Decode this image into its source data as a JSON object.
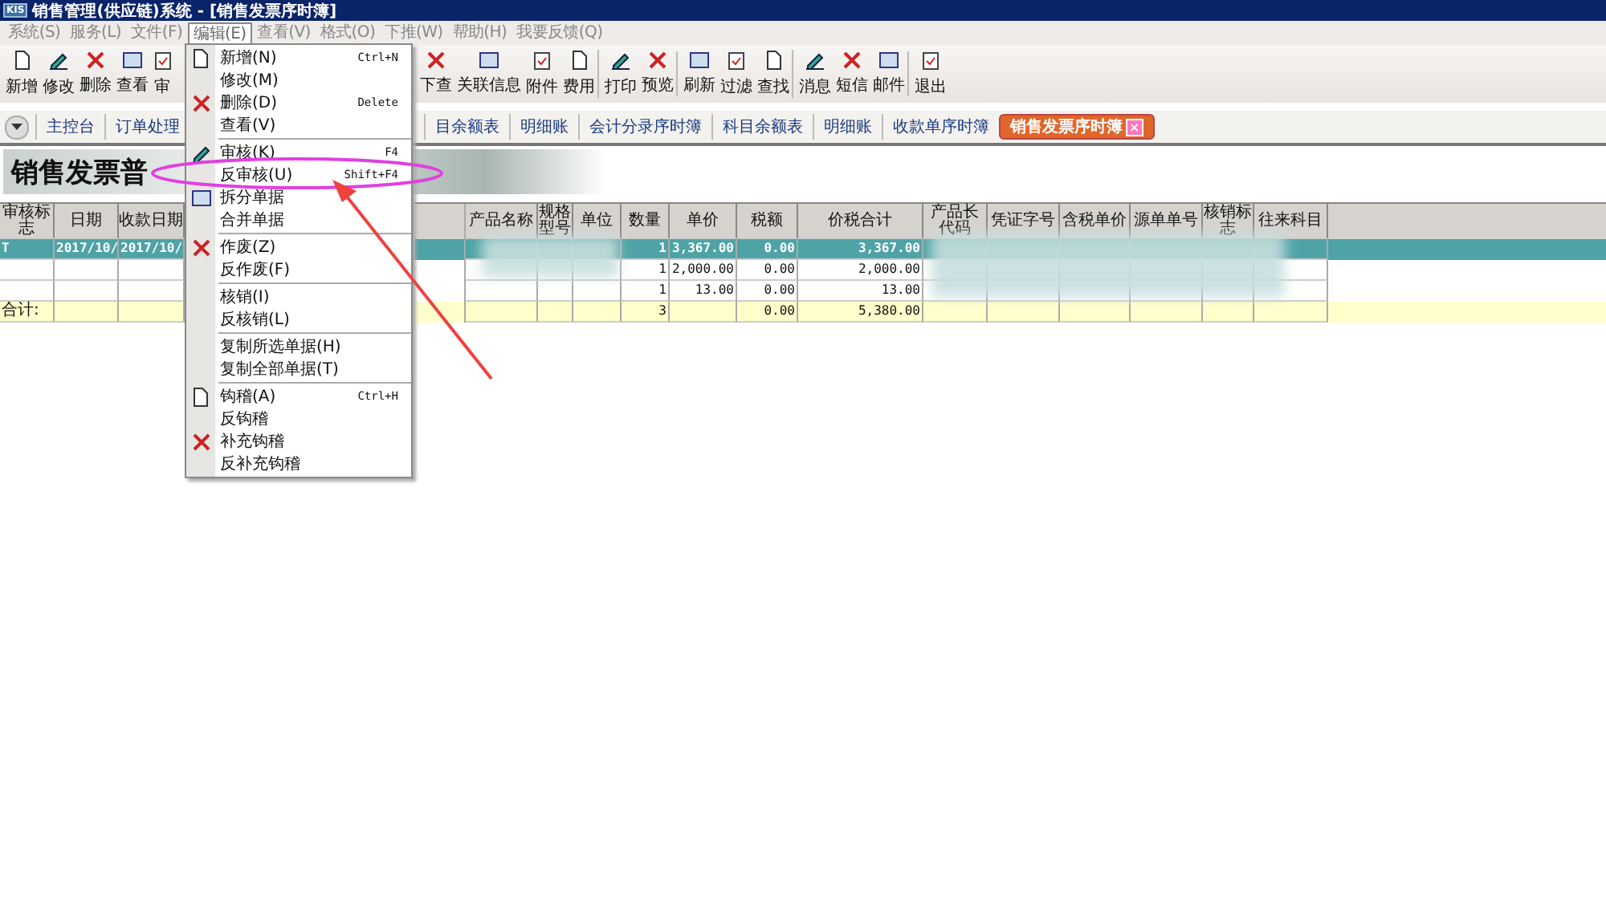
{
  "window": {
    "title": "销售管理(供应链)系统 - [销售发票序时簿]",
    "logo": "KIS"
  },
  "menu_bar": [
    {
      "label": "系统(S)",
      "selected": false
    },
    {
      "label": "服务(L)",
      "selected": false
    },
    {
      "label": "文件(F)",
      "selected": false
    },
    {
      "label": "编辑(E)",
      "selected": true
    },
    {
      "label": "查看(V)",
      "selected": false
    },
    {
      "label": "格式(O)",
      "selected": false
    },
    {
      "label": "下推(W)",
      "selected": false
    },
    {
      "label": "帮助(H)",
      "selected": false
    },
    {
      "label": "我要反馈(Q)",
      "selected": false
    }
  ],
  "toolbar_left": [
    {
      "label": "新增"
    },
    {
      "label": "修改"
    },
    {
      "label": "删除"
    },
    {
      "label": "查看"
    },
    {
      "label": "审"
    }
  ],
  "toolbar_right": [
    {
      "label": "下查",
      "group_end": false
    },
    {
      "label": "关联信息",
      "group_end": false
    },
    {
      "label": "附件",
      "group_end": false
    },
    {
      "label": "费用",
      "group_end": true
    },
    {
      "label": "打印",
      "group_end": false
    },
    {
      "label": "预览",
      "group_end": true
    },
    {
      "label": "刷新",
      "group_end": false
    },
    {
      "label": "过滤",
      "group_end": false
    },
    {
      "label": "查找",
      "group_end": true
    },
    {
      "label": "消息",
      "group_end": false
    },
    {
      "label": "短信",
      "group_end": false
    },
    {
      "label": "邮件",
      "group_end": true
    },
    {
      "label": "退出",
      "group_end": false
    }
  ],
  "tabs_left": [
    {
      "label": "主控台",
      "selected": false
    },
    {
      "label": "订单处理",
      "selected": false
    }
  ],
  "tabs_right": [
    {
      "label": "目余额表",
      "selected": false
    },
    {
      "label": "明细账",
      "selected": false
    },
    {
      "label": "会计分录序时簿",
      "selected": false
    },
    {
      "label": "科目余额表",
      "selected": false
    },
    {
      "label": "明细账",
      "selected": false
    },
    {
      "label": "收款单序时簿",
      "selected": false
    },
    {
      "label": "销售发票序时簿",
      "selected": true,
      "close": "×"
    }
  ],
  "banner": {
    "title": "销售发票普"
  },
  "table": {
    "columns_left": [
      {
        "label": "审核标志"
      },
      {
        "label": "日期"
      },
      {
        "label": "收款日期"
      }
    ],
    "columns_right": [
      {
        "label": "产品名称"
      },
      {
        "label": "规格型号"
      },
      {
        "label": "单位"
      },
      {
        "label": "数量"
      },
      {
        "label": "单价"
      },
      {
        "label": "税额"
      },
      {
        "label": "价税合计"
      },
      {
        "label": "产品长代码"
      },
      {
        "label": "凭证字号"
      },
      {
        "label": "含税单价"
      },
      {
        "label": "源单单号"
      },
      {
        "label": "核销标志"
      },
      {
        "label": "往来科目"
      }
    ],
    "rows": [
      {
        "kind": "data",
        "selected": true,
        "audit": "T",
        "date": "2017/10/",
        "receipt_date": "2017/10/",
        "quantity": "1",
        "unit_price": "3,367.00",
        "tax": "0.00",
        "total": "3,367.00"
      },
      {
        "kind": "data",
        "selected": false,
        "quantity": "1",
        "unit_price": "2,000.00",
        "tax": "0.00",
        "total": "2,000.00"
      },
      {
        "kind": "data",
        "selected": false,
        "quantity": "1",
        "unit_price": "13.00",
        "tax": "0.00",
        "total": "13.00"
      },
      {
        "kind": "total",
        "selected": false,
        "audit": "合计:",
        "quantity": "3",
        "tax": "0.00",
        "total": "5,380.00"
      }
    ]
  },
  "edit_menu": {
    "groups": [
      [
        {
          "label": "新增(N)",
          "shortcut": "Ctrl+N"
        },
        {
          "label": "修改(M)"
        },
        {
          "label": "删除(D)",
          "shortcut": "Delete"
        },
        {
          "label": "查看(V)"
        }
      ],
      [
        {
          "label": "审核(K)",
          "shortcut": "F4"
        },
        {
          "label": "反审核(U)",
          "shortcut": "Shift+F4"
        },
        {
          "label": "拆分单据"
        },
        {
          "label": "合并单据"
        }
      ],
      [
        {
          "label": "作废(Z)"
        },
        {
          "label": "反作废(F)"
        }
      ],
      [
        {
          "label": "核销(I)"
        },
        {
          "label": "反核销(L)"
        }
      ],
      [
        {
          "label": "复制所选单据(H)"
        },
        {
          "label": "复制全部单据(T)"
        }
      ],
      [
        {
          "label": "钩稽(A)",
          "shortcut": "Ctrl+H"
        },
        {
          "label": "反钩稽"
        },
        {
          "label": "补充钩稽"
        },
        {
          "label": "反补充钩稽"
        }
      ]
    ]
  }
}
